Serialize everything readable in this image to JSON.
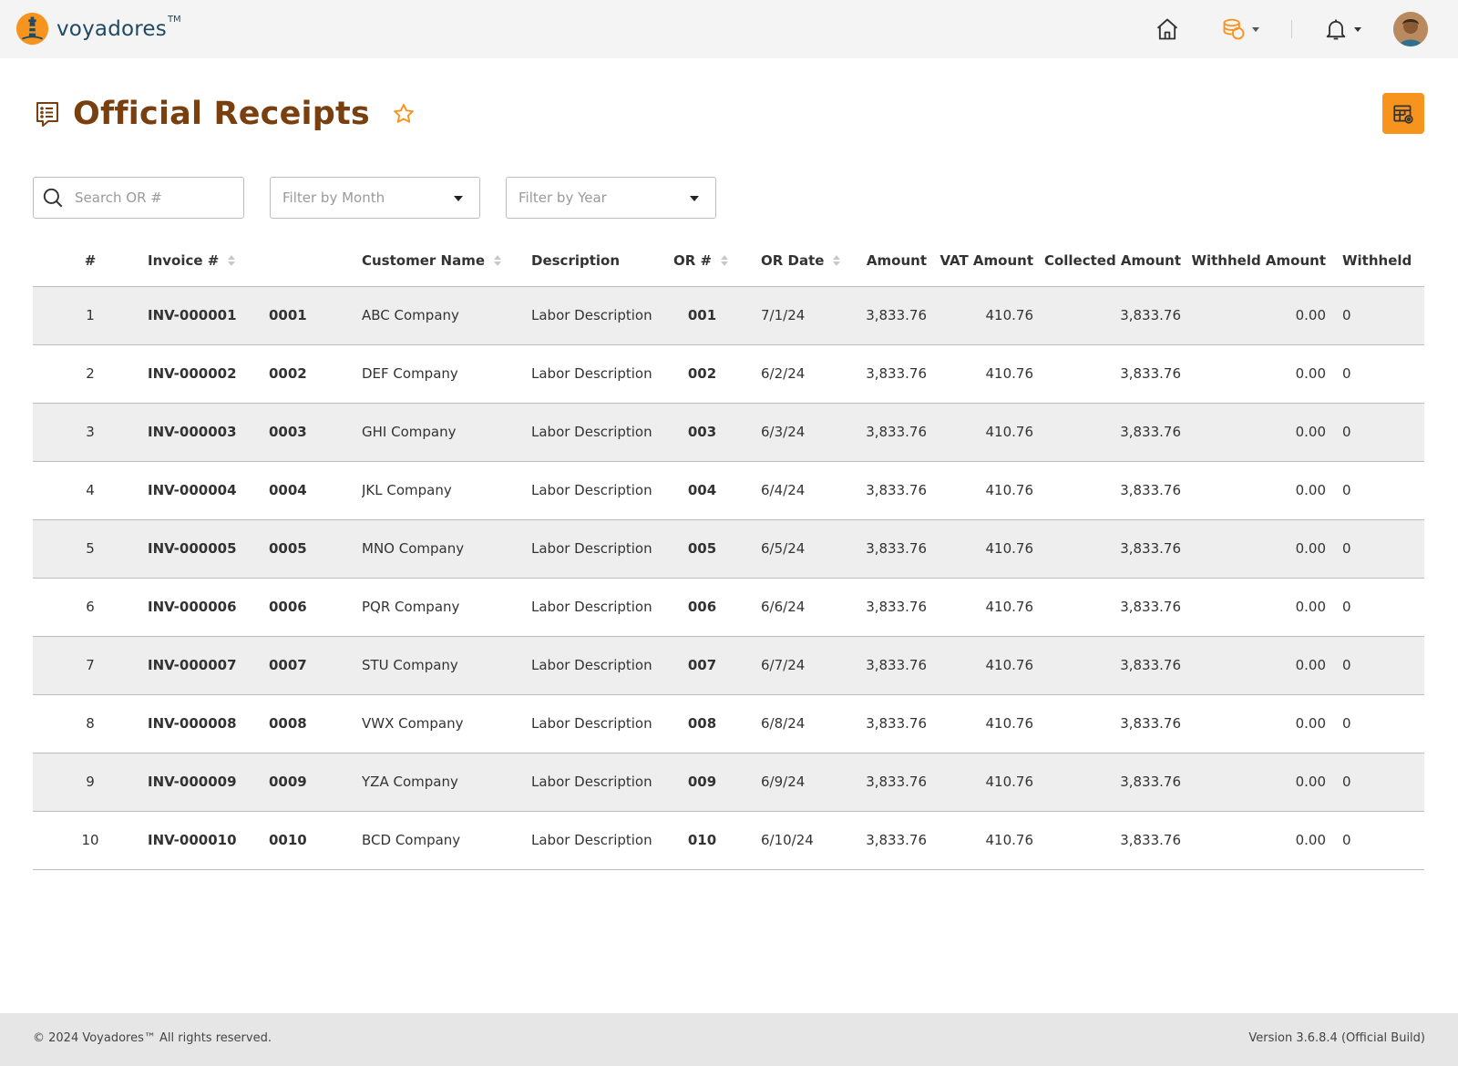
{
  "brand": {
    "name": "voyadores",
    "tm": "TM"
  },
  "header": {
    "icons": [
      "home-icon",
      "coins-icon",
      "bell-icon"
    ],
    "accent": "#f7941d"
  },
  "page": {
    "title": "Official Receipts"
  },
  "filters": {
    "search_placeholder": "Search OR #",
    "month_placeholder": "Filter by Month",
    "year_placeholder": "Filter by Year"
  },
  "table": {
    "columns": [
      "#",
      "Invoice #",
      "",
      "Customer Name",
      "Description",
      "OR #",
      "OR Date",
      "Amount",
      "VAT Amount",
      "Collected Amount",
      "Withheld Amount",
      "Withheld"
    ],
    "rows": [
      [
        "1",
        "INV-000001",
        "0001",
        "ABC Company",
        "Labor Description",
        "001",
        "7/1/24",
        "3,833.76",
        "410.76",
        "3,833.76",
        "0.00",
        "0"
      ],
      [
        "2",
        "INV-000002",
        "0002",
        "DEF Company",
        "Labor Description",
        "002",
        "6/2/24",
        "3,833.76",
        "410.76",
        "3,833.76",
        "0.00",
        "0"
      ],
      [
        "3",
        "INV-000003",
        "0003",
        "GHI Company",
        "Labor Description",
        "003",
        "6/3/24",
        "3,833.76",
        "410.76",
        "3,833.76",
        "0.00",
        "0"
      ],
      [
        "4",
        "INV-000004",
        "0004",
        "JKL Company",
        "Labor Description",
        "004",
        "6/4/24",
        "3,833.76",
        "410.76",
        "3,833.76",
        "0.00",
        "0"
      ],
      [
        "5",
        "INV-000005",
        "0005",
        "MNO Company",
        "Labor Description",
        "005",
        "6/5/24",
        "3,833.76",
        "410.76",
        "3,833.76",
        "0.00",
        "0"
      ],
      [
        "6",
        "INV-000006",
        "0006",
        "PQR Company",
        "Labor Description",
        "006",
        "6/6/24",
        "3,833.76",
        "410.76",
        "3,833.76",
        "0.00",
        "0"
      ],
      [
        "7",
        "INV-000007",
        "0007",
        "STU Company",
        "Labor Description",
        "007",
        "6/7/24",
        "3,833.76",
        "410.76",
        "3,833.76",
        "0.00",
        "0"
      ],
      [
        "8",
        "INV-000008",
        "0008",
        "VWX Company",
        "Labor Description",
        "008",
        "6/8/24",
        "3,833.76",
        "410.76",
        "3,833.76",
        "0.00",
        "0"
      ],
      [
        "9",
        "INV-000009",
        "0009",
        "YZA Company",
        "Labor Description",
        "009",
        "6/9/24",
        "3,833.76",
        "410.76",
        "3,833.76",
        "0.00",
        "0"
      ],
      [
        "10",
        "INV-000010",
        "0010",
        "BCD Company",
        "Labor Description",
        "010",
        "6/10/24",
        "3,833.76",
        "410.76",
        "3,833.76",
        "0.00",
        "0"
      ]
    ]
  },
  "footer": {
    "copyright": "© 2024 Voyadores™ All rights reserved.",
    "version": "Version 3.6.8.4 (Official Build)"
  }
}
